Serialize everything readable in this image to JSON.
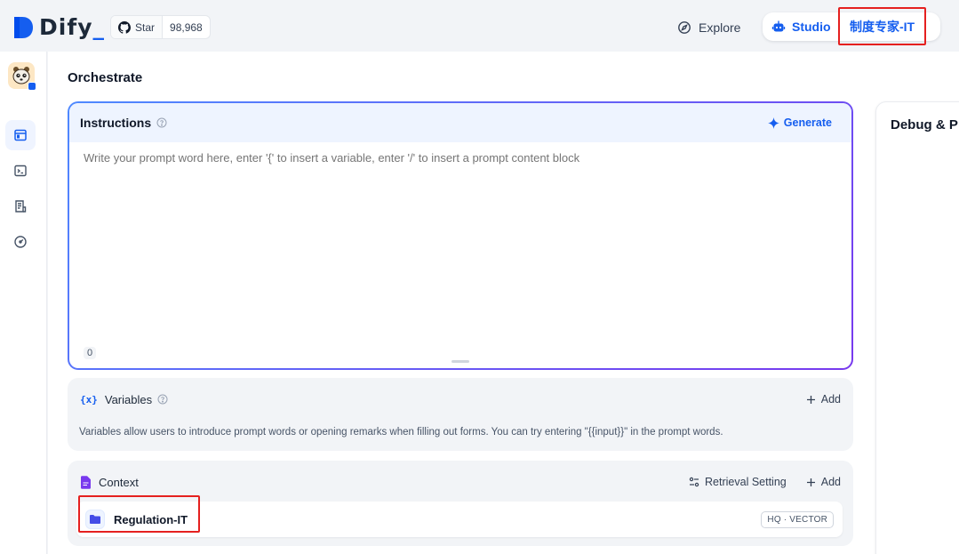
{
  "header": {
    "logo_text": "Dify",
    "logo_cursor": "_",
    "github": {
      "star_label": "Star",
      "count": "98,968"
    },
    "nav": {
      "explore_label": "Explore",
      "studio_label": "Studio"
    },
    "app_name": "制度专家-IT"
  },
  "colors": {
    "accent": "#155eef",
    "highlight_box": "#e5201f",
    "kb_folder": "#444ce7",
    "context_icon": "#7839ee"
  },
  "sidebar": {
    "items": [
      {
        "icon": "layout-icon",
        "active": true
      },
      {
        "icon": "terminal-icon",
        "active": false
      },
      {
        "icon": "log-document-icon",
        "active": false
      },
      {
        "icon": "gauge-icon",
        "active": false
      }
    ]
  },
  "main": {
    "title": "Orchestrate",
    "instructions": {
      "title": "Instructions",
      "generate_label": "Generate",
      "placeholder": "Write your prompt word here, enter '{' to insert a variable, enter '/' to insert a prompt content block",
      "char_count": "0"
    },
    "variables": {
      "icon_text": "{x}",
      "title": "Variables",
      "add_label": "Add",
      "description": "Variables allow users to introduce prompt words or opening remarks when filling out forms. You can try entering \"{{input}}\" in the prompt words."
    },
    "context": {
      "title": "Context",
      "retrieval_setting_label": "Retrieval Setting",
      "add_label": "Add",
      "knowledge": [
        {
          "name": "Regulation-IT",
          "tag": "HQ · VECTOR"
        }
      ]
    }
  },
  "debug": {
    "title": "Debug & P"
  }
}
